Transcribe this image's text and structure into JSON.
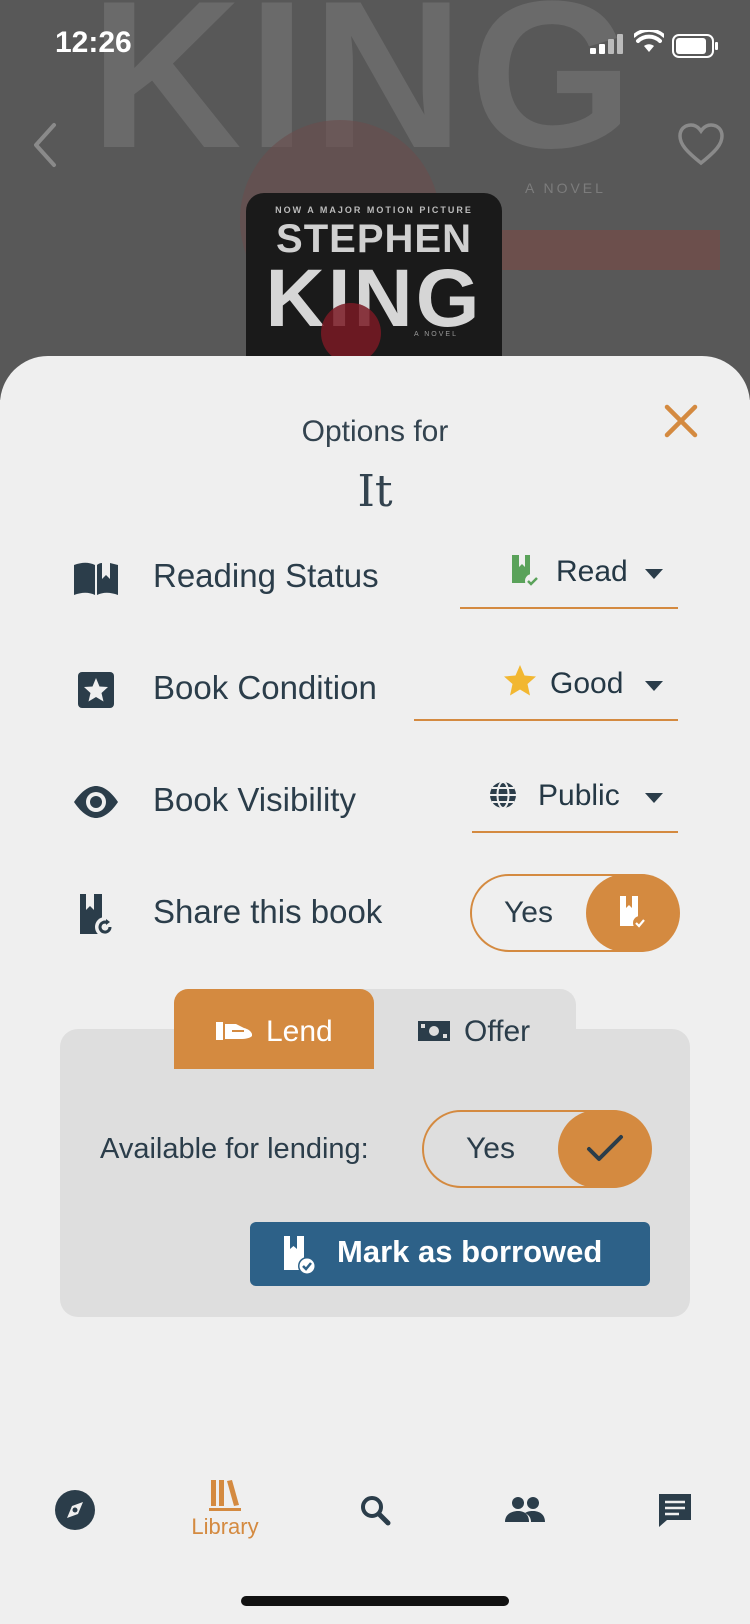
{
  "status_bar": {
    "time": "12:26"
  },
  "hero": {
    "background_text": "KING",
    "background_subtext": "A NOVEL"
  },
  "cover": {
    "tagline": "NOW A MAJOR MOTION PICTURE",
    "author": "STEPHEN",
    "title": "KING",
    "subtitle": "A NOVEL"
  },
  "sheet": {
    "options_label": "Options for",
    "book_title": "It",
    "rows": {
      "reading_status": {
        "label": "Reading Status",
        "value": "Read",
        "icon": "book-open-icon",
        "value_icon": "bookmark-check-icon"
      },
      "book_condition": {
        "label": "Book Condition",
        "value": "Good",
        "icon": "star-square-icon",
        "value_icon": "star-icon"
      },
      "book_visibility": {
        "label": "Book Visibility",
        "value": "Public",
        "icon": "eye-icon",
        "value_icon": "globe-icon"
      },
      "share": {
        "label": "Share this book",
        "toggle_label": "Yes",
        "icon": "share-book-icon",
        "toggle_on": true
      }
    },
    "tabs": [
      {
        "label": "Lend",
        "icon": "hand-icon",
        "active": true
      },
      {
        "label": "Offer",
        "icon": "money-icon",
        "active": false
      }
    ],
    "lend": {
      "available_label": "Available for lending:",
      "available_toggle_label": "Yes",
      "available_on": true,
      "mark_borrowed_label": "Mark as borrowed"
    }
  },
  "nav": {
    "items": [
      {
        "label": "",
        "icon": "compass-icon"
      },
      {
        "label": "Library",
        "icon": "library-icon",
        "active": true
      },
      {
        "label": "",
        "icon": "search-icon"
      },
      {
        "label": "",
        "icon": "people-icon"
      },
      {
        "label": "",
        "icon": "chat-icon"
      }
    ]
  },
  "colors": {
    "accent": "#d48a40",
    "dark": "#2b3d4a",
    "button_blue": "#2d6188",
    "sheet_bg": "#efefef",
    "panel_bg": "#dedede",
    "green": "#5aa25a",
    "star": "#f2b731"
  }
}
